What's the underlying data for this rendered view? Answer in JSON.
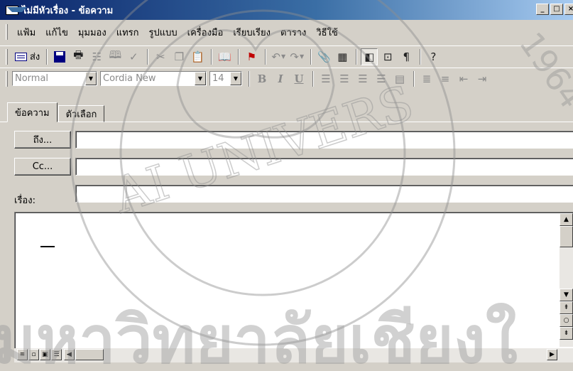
{
  "window": {
    "title": "ไม่มีหัวเรื่อง - ข้อความ",
    "buttons": [
      "_",
      "□",
      "×"
    ]
  },
  "menubar": {
    "items": [
      "แฟ้ม",
      "แก้ไข",
      "มุมมอง",
      "แทรก",
      "รูปแบบ",
      "เครื่องมือ",
      "เรียบเรียง",
      "ตาราง",
      "วิธีใช้"
    ]
  },
  "toolbar": {
    "send_label": "ส่ง"
  },
  "format_bar": {
    "style_value": "Normal",
    "font_value": "Cordia New",
    "size_value": "14",
    "bold": "B",
    "italic": "I",
    "underline": "U"
  },
  "tabs": [
    {
      "label": "ข้อความ",
      "active": true
    },
    {
      "label": "ตัวเลือก",
      "active": false
    }
  ],
  "compose": {
    "to_button": "ถึง...",
    "cc_button": "Cc...",
    "subject_label": "เรื่อง:",
    "to_value": "",
    "cc_value": "",
    "subject_value": "",
    "body_value": ""
  },
  "colors": {
    "title_start": "#0a246a",
    "title_end": "#a6caf0",
    "face": "#d4d0c8",
    "watermark": "#c0c0c0"
  },
  "watermark": {
    "text_latin": "AI UNIVERS",
    "text_thai": "มหาวิทยาลัยเชียงใ",
    "year_text": "1964"
  }
}
